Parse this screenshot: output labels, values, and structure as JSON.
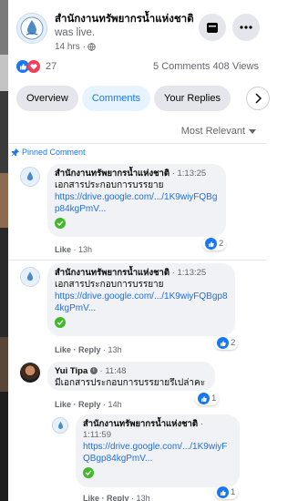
{
  "header": {
    "page_name": "สำนักงานทรัพยากรน้ำแห่งชาติ",
    "live_text": "was live.",
    "time": "14 hrs ·",
    "icons": [
      "globe-icon",
      "messenger-icon",
      "more-icon"
    ]
  },
  "stats": {
    "reactions_count": "27",
    "comments_views": "5 Comments 408 Views",
    "reaction_icons": [
      "like-icon",
      "love-icon"
    ]
  },
  "tabs": [
    {
      "label": "Overview"
    },
    {
      "label": "Comments"
    },
    {
      "label": "Your Replies"
    }
  ],
  "sort": {
    "label": "Most Relevant"
  },
  "pinned": {
    "label": "Pinned Comment"
  },
  "comments": [
    {
      "author": "สำนักงานทรัพยากรน้ำแห่งชาติ",
      "stamp": "· 1:13:25",
      "text": "เอกสารประกอบการบรรยาย",
      "link": "https://drive.google.com/.../1K9wiyFQBgp84kgPmV...",
      "actions": {
        "like": "Like",
        "time": "· 13h"
      },
      "reactions": "2"
    },
    {
      "author": "สำนักงานทรัพยากรน้ำแห่งชาติ",
      "stamp": "· 1:13:25",
      "text": "เอกสารประกอบการบรรยาย",
      "link": "https://drive.google.com/.../1K9wiyFQBgp84kgPmV...",
      "actions": {
        "like": "Like",
        "reply": "· Reply",
        "time": "· 13h"
      },
      "reactions": "2"
    },
    {
      "author": "Yui Tipa",
      "stamp": "· 11:48",
      "text": "มีเอกสารประกอบการบรรยายรึเปล่าคะ",
      "actions": {
        "like": "Like",
        "reply": "· Reply",
        "time": "· 14h"
      },
      "reactions": "1"
    },
    {
      "author": "สำนักงานทรัพยากรน้ำแห่งชาติ",
      "stamp": "·",
      "stamp2": "1:11:59",
      "link": "https://drive.google.com/.../1K9wiyFQBgp84kgPmV...",
      "actions": {
        "like": "Like",
        "reply": "· Reply",
        "time": "· 13h"
      },
      "reactions": "1"
    }
  ],
  "colors": {
    "accent": "#1877f2",
    "link": "#216fdb",
    "bubble": "#f0f2f5",
    "tab": "#e4e6eb",
    "verify": "#42b72a"
  }
}
